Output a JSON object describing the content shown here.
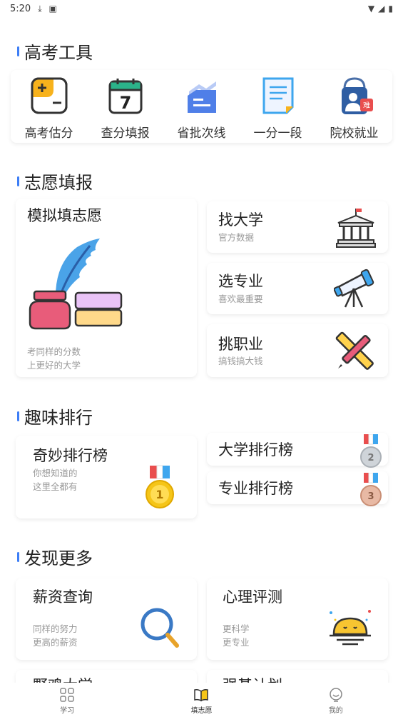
{
  "status_bar": {
    "time": "5:20"
  },
  "sections": {
    "tools": "高考工具",
    "volunteer": "志愿填报",
    "rank": "趣味排行",
    "more": "发现更多"
  },
  "tools": [
    {
      "label": "高考估分",
      "icon": "calculator-icon"
    },
    {
      "label": "查分填报",
      "icon": "calendar-icon"
    },
    {
      "label": "省批次线",
      "icon": "chart-doc-icon"
    },
    {
      "label": "一分一段",
      "icon": "document-icon"
    },
    {
      "label": "院校就业",
      "icon": "badge-icon"
    }
  ],
  "volunteer": {
    "simulate": {
      "title": "模拟填志愿",
      "desc1": "考同样的分数",
      "desc2": "上更好的大学"
    },
    "find_univ": {
      "title": "找大学",
      "desc": "官方数据"
    },
    "choose_major": {
      "title": "选专业",
      "desc": "喜欢最重要"
    },
    "pick_career": {
      "title": "挑职业",
      "desc": "搞钱搞大钱"
    }
  },
  "rank": {
    "wonder": {
      "title": "奇妙排行榜",
      "desc1": "你想知道的",
      "desc2": "这里全都有"
    },
    "univ": {
      "title": "大学排行榜"
    },
    "major": {
      "title": "专业排行榜"
    }
  },
  "more": {
    "salary": {
      "title": "薪资查询",
      "desc1": "同样的努力",
      "desc2": "更高的薪资"
    },
    "psych": {
      "title": "心理评测",
      "desc1": "更科学",
      "desc2": "更专业"
    },
    "partial_left": "野鸡大学",
    "partial_right": "强基计划"
  },
  "tabbar": [
    {
      "label": "学习",
      "icon": "grid-icon"
    },
    {
      "label": "填志愿",
      "icon": "book-icon",
      "active": true
    },
    {
      "label": "我的",
      "icon": "profile-icon"
    }
  ],
  "colors": {
    "accent": "#3d7ef6",
    "gold": "#f5c518"
  }
}
